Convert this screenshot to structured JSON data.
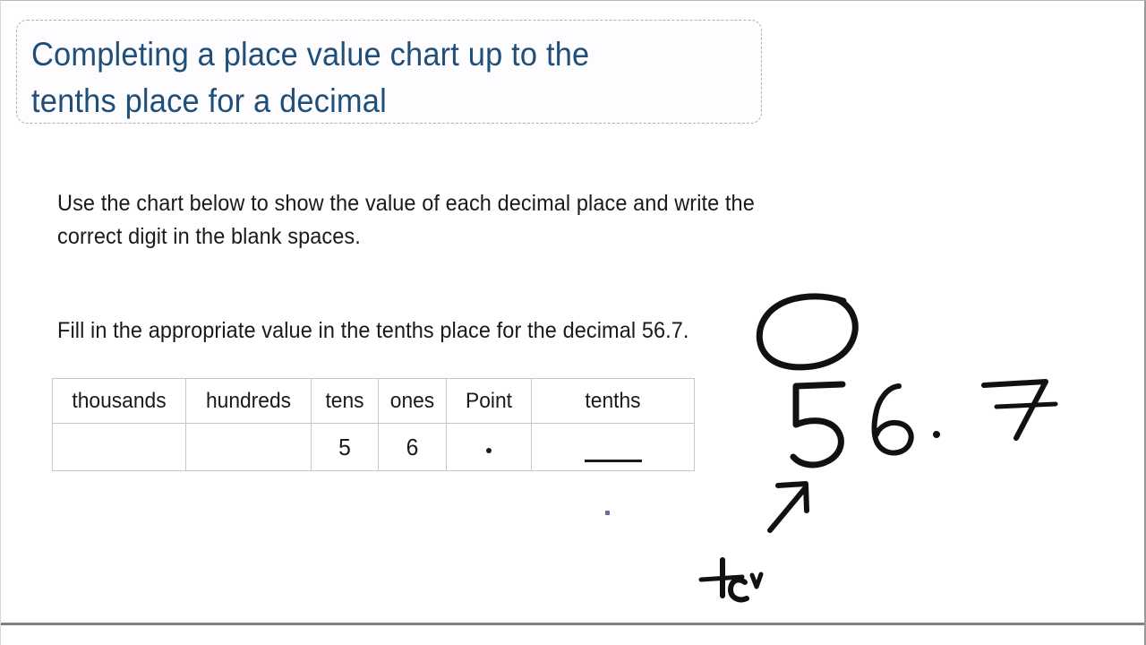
{
  "slide": {
    "title": "Completing a place value chart up to the\ntenths place for a decimal",
    "title_color": "#1F4E79",
    "instruction": "Use the chart below to show the value of each decimal place and write the\ncorrect digit in the blank spaces.",
    "prompt": "Fill in the appropriate value in the tenths place for the decimal 56.7."
  },
  "table": {
    "headers": [
      "thousands",
      "hundreds",
      "tens",
      "ones",
      "Point",
      "tenths"
    ],
    "values": [
      "",
      "",
      "5",
      "6",
      ".",
      ""
    ],
    "tenths_blank": true
  },
  "annotations": {
    "ink_color": "#111111",
    "circled_value": "56.7.",
    "written_digits": [
      "5",
      "6",
      ".",
      "7"
    ],
    "arrow": "up-right-arrow",
    "partial_word": "te"
  }
}
